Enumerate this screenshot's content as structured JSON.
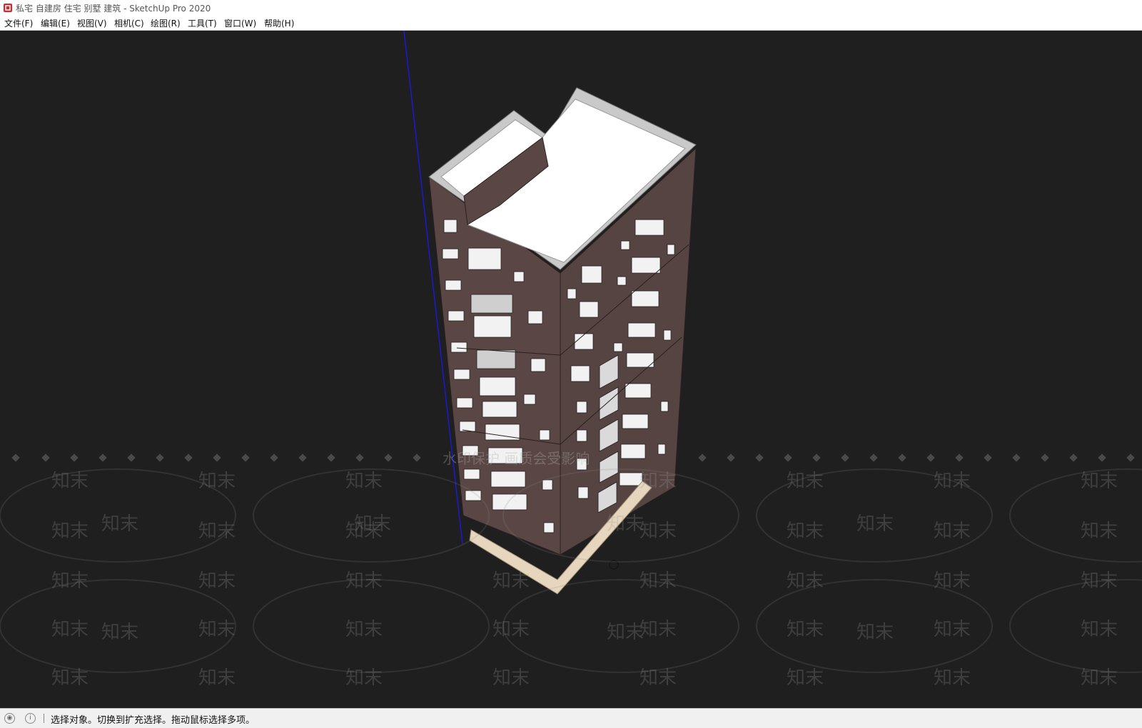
{
  "window": {
    "title": "私宅 自建房 住宅 别墅 建筑 - SketchUp Pro 2020"
  },
  "menu": [
    {
      "label": "文件(F)"
    },
    {
      "label": "编辑(E)"
    },
    {
      "label": "视图(V)"
    },
    {
      "label": "相机(C)"
    },
    {
      "label": "绘图(R)"
    },
    {
      "label": "工具(T)"
    },
    {
      "label": "窗口(W)"
    },
    {
      "label": "帮助(H)"
    }
  ],
  "viewport": {
    "background_color": "#1f1f1f",
    "model": "high-rise residential building",
    "wall_color": "#5a4745",
    "roof_color": "#ffffff",
    "base_color": "#e6d6bd",
    "blue_axis_color": "#1a1ad0"
  },
  "watermark": {
    "text": "知末",
    "banner": "水印保护 画质会受影响"
  },
  "status": {
    "text": "选择对象。切换到扩充选择。拖动鼠标选择多项。"
  },
  "icons": [
    "sketchup-logo-icon",
    "geolocation-icon",
    "info-icon"
  ]
}
